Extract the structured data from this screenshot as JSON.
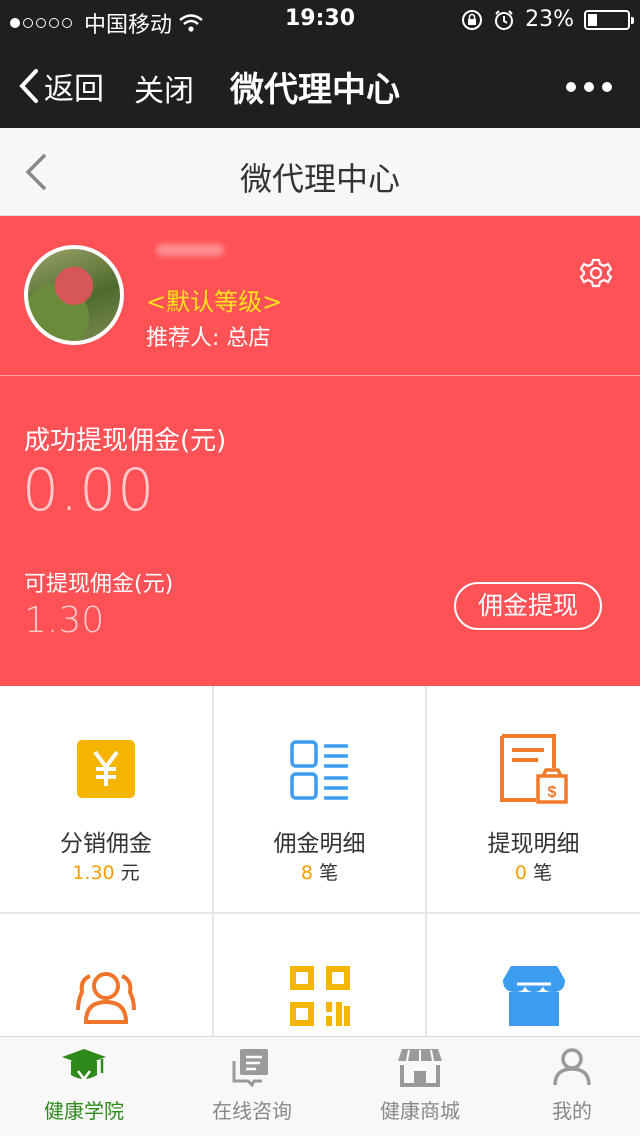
{
  "status_bar": {
    "carrier": "中国移动",
    "time": "19:30",
    "battery": "23%",
    "battery_level": 0.23
  },
  "wechat_nav": {
    "back_label": "返回",
    "close_label": "关闭",
    "title": "微代理中心"
  },
  "page_header": {
    "title": "微代理中心"
  },
  "profile": {
    "level": "<默认等级>",
    "referrer": "推荐人: 总店"
  },
  "commission": {
    "success_label": "成功提现佣金(元)",
    "success_value": "0.00",
    "available_label": "可提现佣金(元)",
    "available_value": "1.30",
    "withdraw_button": "佣金提现"
  },
  "grid": [
    {
      "label": "分销佣金",
      "value": "1.30",
      "unit": "元",
      "icon": "yuan-icon"
    },
    {
      "label": "佣金明细",
      "value": "8",
      "unit": "笔",
      "icon": "list-icon"
    },
    {
      "label": "提现明细",
      "value": "0",
      "unit": "笔",
      "icon": "withdraw-receipt-icon"
    },
    {
      "icon": "team-icon"
    },
    {
      "icon": "qrcode-icon"
    },
    {
      "icon": "shop-icon"
    }
  ],
  "tabbar": [
    {
      "label": "健康学院",
      "icon": "graduation-cap-icon",
      "active": true
    },
    {
      "label": "在线咨询",
      "icon": "consult-icon"
    },
    {
      "label": "健康商城",
      "icon": "store-icon"
    },
    {
      "label": "我的",
      "icon": "user-icon"
    }
  ],
  "colors": {
    "primary_red": "#ff5257",
    "level_yellow": "#ffe21a",
    "accent_orange": "#f5a000",
    "tab_active": "#2f8a1c"
  }
}
